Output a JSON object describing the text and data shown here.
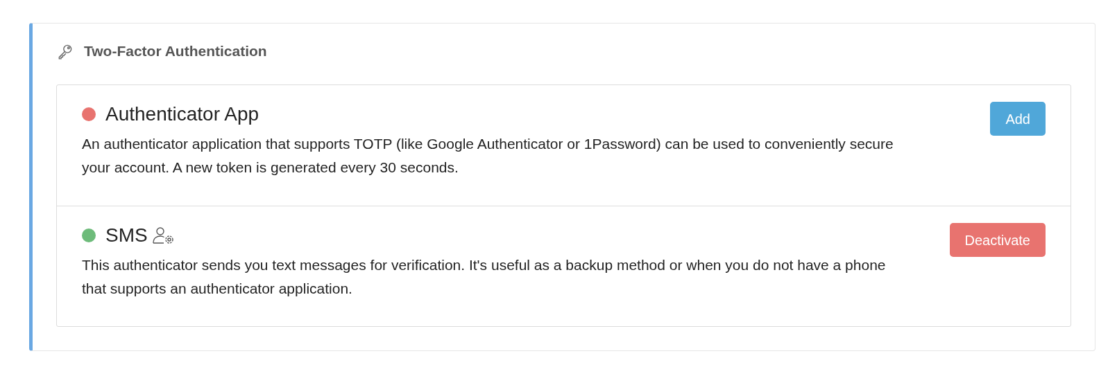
{
  "panel": {
    "title": "Two-Factor Authentication"
  },
  "methods": [
    {
      "name": "Authenticator App",
      "color": "#e8736f",
      "user_settings": false,
      "description": "An authenticator application that supports TOTP (like Google Authenticator or 1Password) can be used to conveniently secure your account. A new token is generated every 30 seconds.",
      "button": {
        "label": "Add",
        "kind": "primary"
      }
    },
    {
      "name": "SMS",
      "color": "#6dbb7a",
      "user_settings": true,
      "description": "This authenticator sends you text messages for verification. It's useful as a backup method or when you do not have a phone that supports an authenticator application.",
      "button": {
        "label": "Deactivate",
        "kind": "danger"
      }
    }
  ]
}
